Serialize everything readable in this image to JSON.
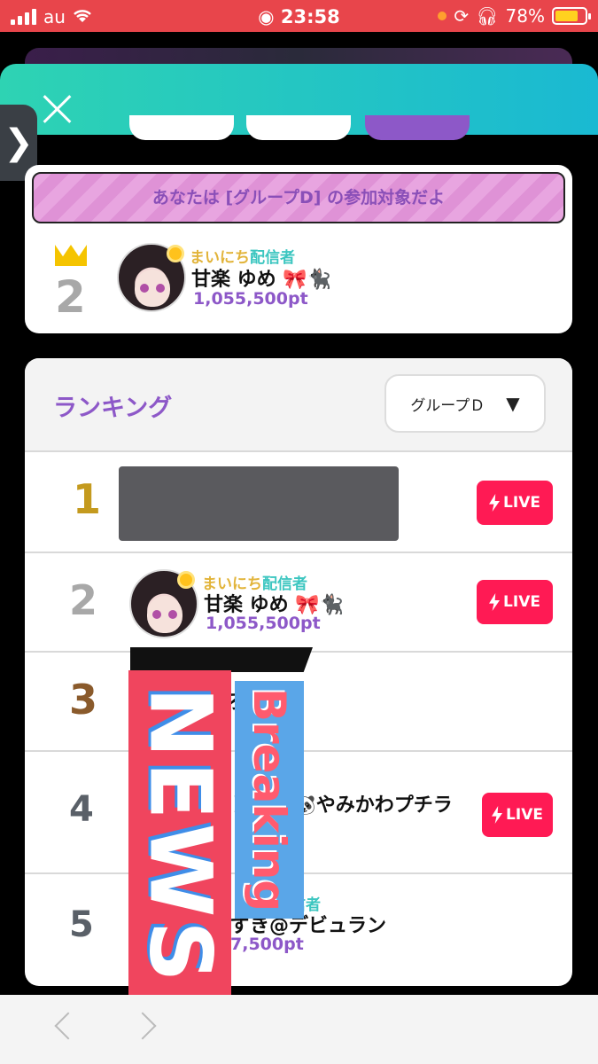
{
  "status_bar": {
    "carrier": "au",
    "time": "23:58",
    "battery": "78%",
    "battery_level": 0.78,
    "colors": {
      "bar": "#e8454b",
      "battery_fill": "#ffd21f"
    }
  },
  "nav": {
    "close_icon": "close-icon",
    "side_tab_glyph": "❯",
    "back_icon": "chevron-left-icon",
    "forward_icon": "chevron-right-icon"
  },
  "group_card": {
    "banner_text": "あなたは [グループD] の参加対象だよ",
    "rank": "2",
    "tag_yellow": "まいにち",
    "tag_teal": "配信者",
    "name": "甘楽 ゆめ 🎀🐈‍⬛",
    "points": "1,055,500pt"
  },
  "ranking": {
    "title": "ランキング",
    "group_select": "グループＤ",
    "select_arrow": "▼",
    "live_label": "LIVE",
    "rows": [
      {
        "rank": "1",
        "rank_color": "#c49a1e",
        "live": true,
        "hidden": true
      },
      {
        "rank": "2",
        "rank_color": "#a8a8a8",
        "live": true,
        "tag_yellow": "まいにち",
        "tag_teal": "配信者",
        "name": "甘楽 ゆめ 🎀🐈‍⬛",
        "points": "1,055,500pt"
      },
      {
        "rank": "3",
        "rank_color": "#8a5a2b",
        "live": false,
        "name_partial": "ろ　　こ"
      },
      {
        "rank": "4",
        "rank_color": "#5a6068",
        "live": true,
        "name_partial": "ト　💙🐼やみかわプチラ"
      },
      {
        "rank": "5",
        "rank_color": "#5a6068",
        "live": false,
        "tag_teal": "信者",
        "name_partial": "ずき@デビュラン",
        "points_partial": "7,500pt"
      }
    ]
  },
  "overlay": {
    "news": "NEWS",
    "breaking": "Breaking"
  },
  "colors": {
    "accent_purple": "#8d58c8",
    "live_red": "#ff1a54",
    "teal_header": "#1ab9d2",
    "news_red": "#f0455e",
    "breaking_blue": "#5aa6e8"
  }
}
